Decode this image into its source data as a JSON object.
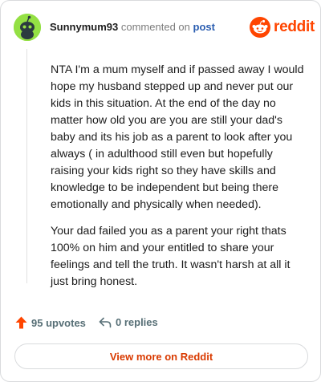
{
  "comment": {
    "username": "Sunnymum93",
    "verb": "commented on",
    "target": "post",
    "paragraphs": [
      "NTA I'm a mum myself and if passed away I would hope my husband stepped up and never put our kids in this situation. At the end of the day no matter how old you are you are still your dad's baby and its his job as a parent to look after you always ( in adulthood still even but hopefully raising your kids right so they have skills and knowledge to be independent but being there emotionally and physically when needed).",
      "Your dad failed you as a parent your right thats 100% on him and your entitled to share your feelings and tell the truth. It wasn't harsh at all it just bring honest."
    ]
  },
  "brand": {
    "name": "reddit",
    "color": "#ff4500",
    "icon": "reddit-snoo-icon"
  },
  "avatar": {
    "icon": "snoo-avatar-icon",
    "color": "#94e044"
  },
  "actions": {
    "upvotes": "95 upvotes",
    "replies": "0 replies",
    "upvote_icon": "upvote-arrow-icon",
    "reply_icon": "reply-arrow-icon",
    "upvote_color": "#ff4500"
  },
  "view_more": {
    "label": "View more on Reddit",
    "color": "#d93a00"
  }
}
